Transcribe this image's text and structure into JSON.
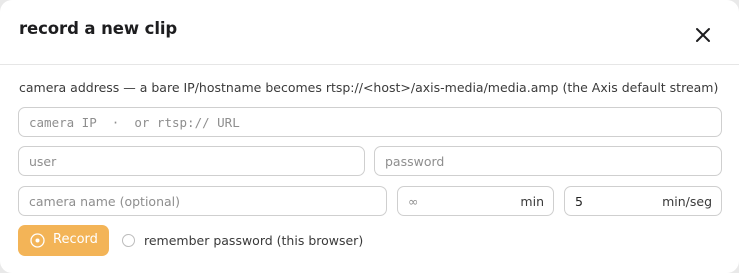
{
  "dialog": {
    "title": "record a new clip",
    "close_icon": "close-icon"
  },
  "hint": "camera address — a bare IP/hostname becomes rtsp://<host>/axis-media/media.amp (the Axis default stream)",
  "fields": {
    "camera_address": {
      "placeholder": "camera IP  ·  or rtsp:// URL",
      "value": ""
    },
    "user": {
      "placeholder": "user",
      "value": ""
    },
    "password": {
      "placeholder": "password",
      "value": ""
    },
    "camera_name": {
      "placeholder": "camera name (optional)",
      "value": ""
    },
    "duration": {
      "placeholder": "∞",
      "value": "",
      "unit": "min"
    },
    "segment": {
      "placeholder": "",
      "value": "5",
      "unit": "min/seg"
    }
  },
  "record_button": {
    "label": "Record",
    "icon": "record-icon",
    "color": "#f3b457"
  },
  "remember": {
    "label": "remember password (this browser)",
    "checked": false
  }
}
